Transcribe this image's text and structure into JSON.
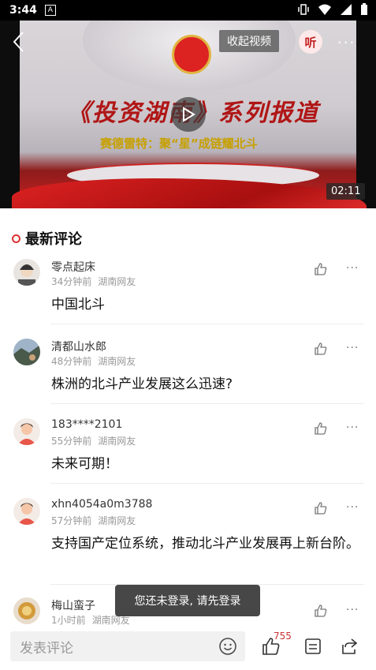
{
  "status_bar": {
    "time": "3:44",
    "a_label": "A"
  },
  "video": {
    "headline": "《投资湖南》系列报道",
    "subline": "赛德雷特：聚“星”成链耀北斗",
    "collapse_label": "收起视频",
    "listen_label": "听",
    "more_label": "···",
    "duration": "02:11"
  },
  "comments_section": {
    "title": "最新评论",
    "items": [
      {
        "name": "零点起床",
        "time": "34分钟前",
        "location": "湖南网友",
        "text": "中国北斗"
      },
      {
        "name": "清都山水郎",
        "time": "48分钟前",
        "location": "湖南网友",
        "text": "株洲的北斗产业发展这么迅速?"
      },
      {
        "name": "183****2101",
        "time": "55分钟前",
        "location": "湖南网友",
        "text": "未来可期！"
      },
      {
        "name": "xhn4054a0m3788",
        "time": "57分钟前",
        "location": "湖南网友",
        "text": "支持国产定位系统，推动北斗产业发展再上新台阶。"
      },
      {
        "name": "梅山蛮子",
        "time": "1小时前",
        "location": "湖南网友",
        "text": ""
      }
    ]
  },
  "toast": "您还未登录, 请先登录",
  "bottom_bar": {
    "comment_placeholder": "发表评论",
    "like_count": "755"
  },
  "colors": {
    "accent": "#c41e1e",
    "like_count": "#cc3333"
  }
}
